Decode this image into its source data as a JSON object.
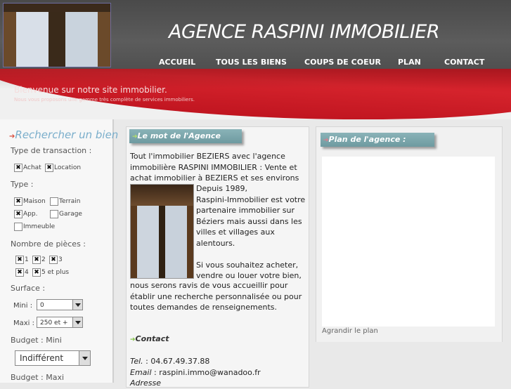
{
  "header": {
    "title": "AGENCE RASPINI IMMOBILIER",
    "nav": [
      "ACCUEIL",
      "TOUS LES BIENS",
      "COUPS DE COEUR",
      "PLAN",
      "CONTACT"
    ]
  },
  "banner": {
    "welcome": "Bienvenue sur notre site immobilier.",
    "subtitle": "Nous vous proposons une gamme très complète de services immobiliers."
  },
  "sidebar": {
    "title": "Rechercher un bien",
    "transaction_label": "Type de transaction :",
    "transaction_options": [
      "Achat",
      "Location"
    ],
    "type_label": "Type :",
    "type_options": [
      "Maison",
      "Terrain",
      "App.",
      "Garage",
      "Immeuble"
    ],
    "rooms_label": "Nombre de pièces :",
    "rooms_options": [
      "1",
      "2",
      "3",
      "4",
      "5 et plus"
    ],
    "surface_label": "Surface :",
    "mini_label": "Mini :",
    "mini_value": "0",
    "maxi_label": "Maxi :",
    "maxi_value": "250 et +",
    "budget_mini_label": "Budget : Mini",
    "budget_mini_value": "Indifférent",
    "budget_maxi_label": "Budget : Maxi"
  },
  "center": {
    "tab_title": "Le mot de l'Agence",
    "intro_lines": [
      "Tout l'immobilier BEZIERS avec l'agence",
      "immobilière RASPINI IMMOBILIER : Vente et",
      "achat immobilier à BEZIERS et ses environs"
    ],
    "side_lines": [
      "Depuis 1989,",
      "Raspini-Immobilier est votre",
      "partenaire immobilier sur",
      "Béziers mais aussi dans les",
      "villes et villages aux",
      "alentours."
    ],
    "side_lines2": [
      "Si vous souhaitez acheter,",
      "vendre ou louer votre bien,"
    ],
    "full_lines": [
      "nous serons ravis de vous accueillir pour",
      "établir une recherche personnalisée ou pour",
      "toutes demandes de renseignements."
    ],
    "contact_title": "Contact",
    "tel_label": "Tel.",
    "tel_value": " : 04.67.49.37.88",
    "email_label": "Email",
    "email_value": " : raspini.immo@wanadoo.fr",
    "address_label": "Adresse"
  },
  "right": {
    "tab_title": "Plan de l'agence :",
    "map_link": "Agrandir le plan"
  }
}
